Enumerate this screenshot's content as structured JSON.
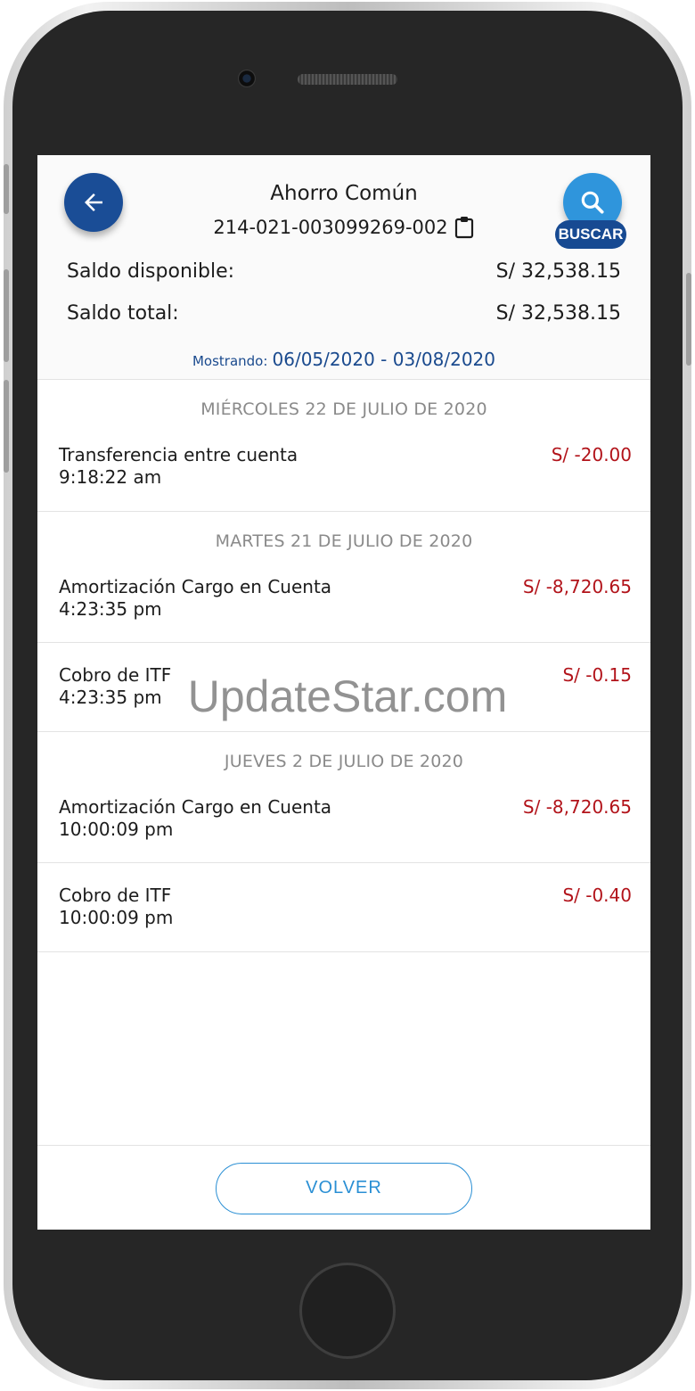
{
  "header": {
    "back_icon": "arrow-left-icon",
    "account_name": "Ahorro Común",
    "account_number": "214-021-003099269-002",
    "copy_icon": "clipboard-icon",
    "search_icon": "magnifier-icon",
    "search_label": "BUSCAR"
  },
  "balances": {
    "available_label": "Saldo disponible:",
    "available_value": "S/ 32,538.15",
    "total_label": "Saldo total:",
    "total_value": "S/ 32,538.15"
  },
  "range": {
    "label": "Mostrando:",
    "value": "06/05/2020 - 03/08/2020"
  },
  "groups": [
    {
      "date": "MIÉRCOLES 22 DE JULIO DE 2020",
      "transactions": [
        {
          "description": "Transferencia entre cuenta",
          "time": "9:18:22 am",
          "amount": "S/ -20.00"
        }
      ]
    },
    {
      "date": "MARTES 21 DE JULIO DE 2020",
      "transactions": [
        {
          "description": "Amortización Cargo en Cuenta",
          "time": "4:23:35 pm",
          "amount": "S/ -8,720.65"
        },
        {
          "description": "Cobro de ITF",
          "time": "4:23:35 pm",
          "amount": "S/ -0.15"
        }
      ]
    },
    {
      "date": "JUEVES 2 DE JULIO DE 2020",
      "transactions": [
        {
          "description": "Amortización Cargo en Cuenta",
          "time": "10:00:09 pm",
          "amount": "S/ -8,720.65"
        },
        {
          "description": "Cobro de ITF",
          "time": "10:00:09 pm",
          "amount": "S/ -0.40"
        }
      ]
    }
  ],
  "footer": {
    "volver_label": "VOLVER"
  },
  "watermark": "UpdateStar.com",
  "colors": {
    "primary_blue": "#1a4d96",
    "search_blue": "#2f95dc",
    "link_blue": "#2a8fd4",
    "negative_amount": "#b2131a"
  }
}
